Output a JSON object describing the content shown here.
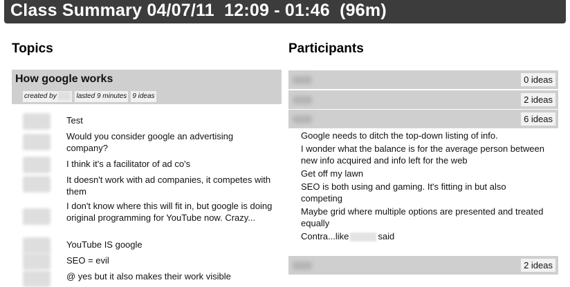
{
  "header": {
    "title": "Class Summary 04/07/11  12:09 - 01:46  (96m)"
  },
  "topics": {
    "heading": "Topics",
    "topic": {
      "title": "How google works",
      "created_by": "created by",
      "lasted": "lasted 9 minutes",
      "ideas_count": "9 ideas"
    },
    "ideas": [
      "Test",
      "Would you consider google an advertising company?",
      "I think it's a facilitator of ad co's",
      "It doesn't work with ad companies, it competes with them",
      "I don't know where this will fit in, but google is doing original programming for YouTube now. Crazy...",
      "YouTube IS google",
      "SEO = evil",
      "@      yes but it also makes their work visible"
    ]
  },
  "participants": {
    "heading": "Participants",
    "list": [
      {
        "count": "0 ideas"
      },
      {
        "count": "2 ideas"
      },
      {
        "count": "6 ideas"
      },
      {
        "count": "2 ideas"
      }
    ],
    "ideas": [
      "Google needs to ditch the top-down listing of info.",
      "I wonder what the balance is for the average person between new info acquired and info left for the web",
      "Get off my lawn",
      "SEO is both using and gaming. It's fitting in but also competing",
      "Maybe grid where multiple options are presented and treated equally"
    ],
    "last_idea_prefix": "Contra...like",
    "last_idea_suffix": "said"
  }
}
